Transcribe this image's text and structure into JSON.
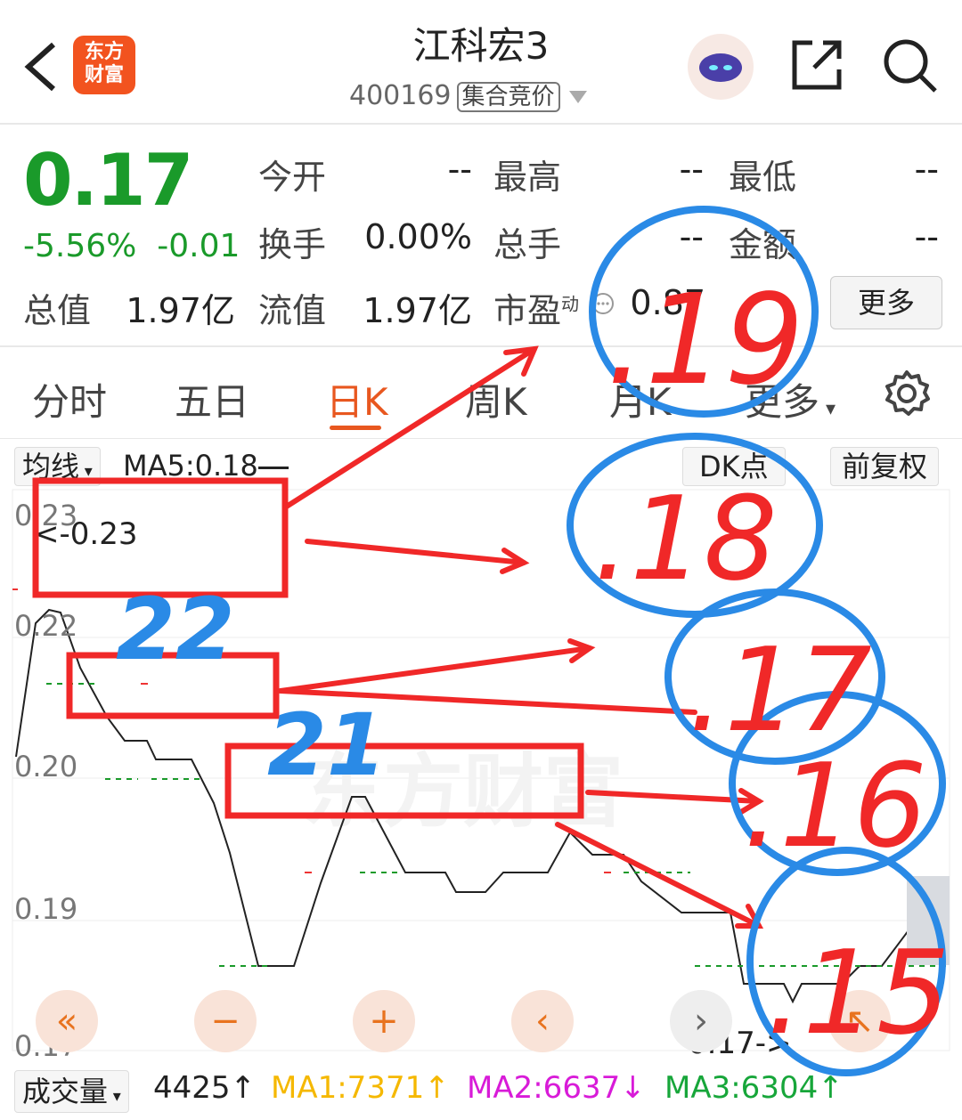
{
  "header": {
    "title": "江科宏3",
    "code": "400169",
    "tag": "集合竞价",
    "logo_line1": "东方",
    "logo_line2": "财富"
  },
  "quote": {
    "price": "0.17",
    "change_pct": "-5.56%",
    "change_abs": "-0.01",
    "open_label": "今开",
    "open_value": "--",
    "high_label": "最高",
    "high_value": "--",
    "low_label": "最低",
    "low_value": "--",
    "turnover_label": "换手",
    "turnover_value": "0.00%",
    "volume_label": "总手",
    "volume_value": "--",
    "amount_label": "金额",
    "amount_value": "--",
    "mcap_label": "总值",
    "mcap_value": "1.97亿",
    "float_label": "流值",
    "float_value": "1.97亿",
    "pe_label": "市盈",
    "pe_sup": "动",
    "pe_value": "0.87",
    "more": "更多"
  },
  "tabs": [
    "分时",
    "五日",
    "日K",
    "周K",
    "月K",
    "更多"
  ],
  "chart": {
    "ma_select": "均线",
    "ma5": "MA5:0.18",
    "dk": "DK点",
    "fq": "前复权",
    "max_marker": "<-0.23",
    "min_marker": "0.17->",
    "y_labels": [
      "0.23",
      "0.22",
      "0.20",
      "0.19",
      "0.17"
    ],
    "line_color": "#222222"
  },
  "volume": {
    "select": "成交量",
    "vol": "4425↑",
    "ma1": "MA1:7371↑",
    "ma2": "MA2:6637↓",
    "ma3": "MA3:6304↑",
    "ma1_color": "#f5b800",
    "ma2_color": "#d81bd8",
    "ma3_color": "#17a63a"
  },
  "annotations": {
    "labels": [
      ".22",
      ".21",
      ".19",
      ".18",
      ".17",
      ".16",
      ".15"
    ],
    "labels_display": [
      "22",
      "21",
      ".19",
      ".18",
      ".17",
      ".16",
      ".15"
    ]
  },
  "colors": {
    "accent": "#e8571f",
    "down": "#1a9a2a",
    "ink_red": "#f02828",
    "ink_blue": "#2a8ae6"
  }
}
